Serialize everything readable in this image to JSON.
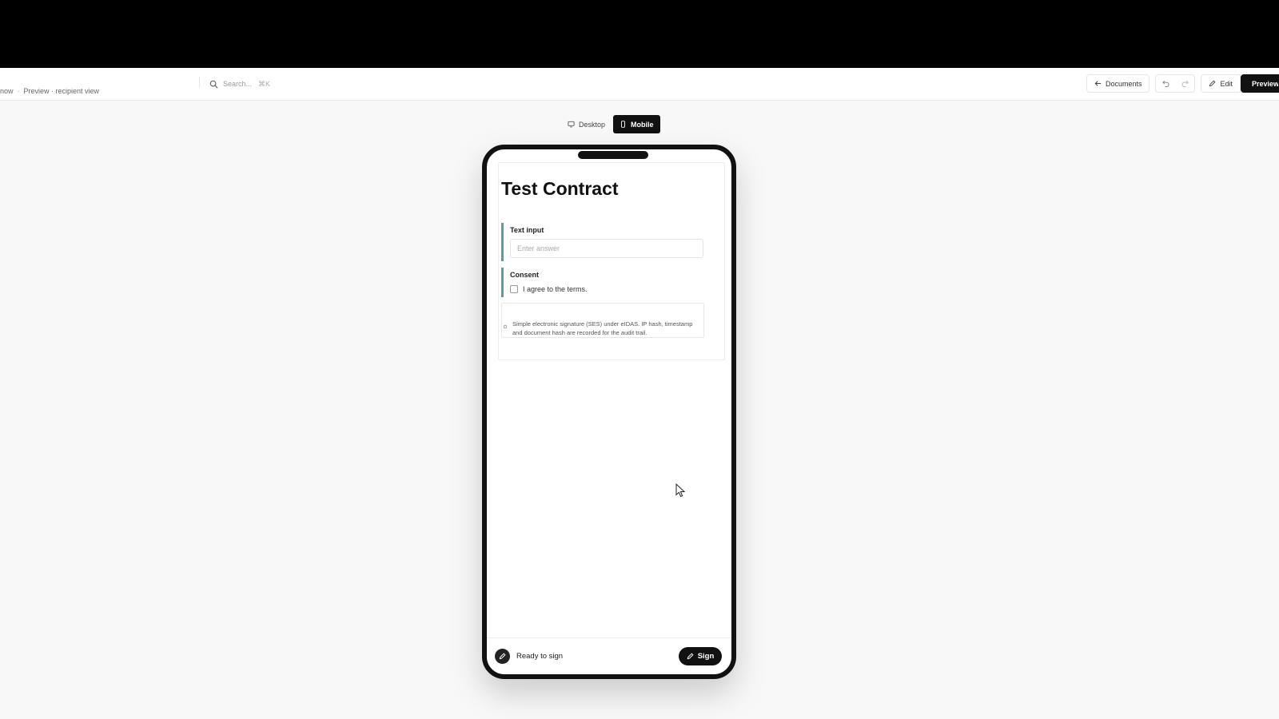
{
  "header": {
    "breadcrumb": [
      "now",
      "Preview · recipient view"
    ],
    "search_placeholder": "Search...",
    "search_shortcut": "⌘K"
  },
  "toolbar": {
    "documents_label": "Documents",
    "edit_label": "Edit",
    "preview_label": "Preview"
  },
  "view_toggle": {
    "desktop_label": "Desktop",
    "mobile_label": "Mobile",
    "active": "Mobile"
  },
  "document": {
    "title": "Test Contract",
    "text_field_label": "Text input",
    "text_field_placeholder": "Enter answer",
    "text_field_value": "",
    "consent_label": "Consent",
    "consent_text": "I agree to the terms.",
    "consent_checked": false,
    "signature_notice": "Simple electronic signature (SES) under eIDAS. IP hash, timestamp and document hash are recorded for the audit trail."
  },
  "footer": {
    "status_text": "Ready to sign",
    "sign_label": "Sign"
  },
  "colors": {
    "field_accent": "#5b9aa6",
    "primary": "#111111"
  }
}
